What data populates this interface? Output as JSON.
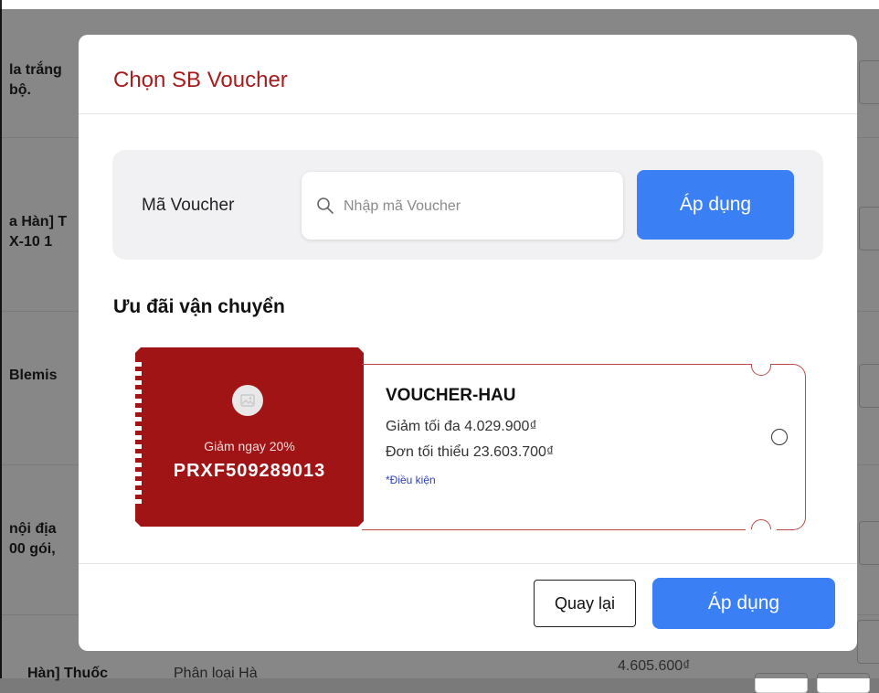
{
  "background": {
    "rows": [
      {
        "line1": "la trắng",
        "line2": "bộ."
      },
      {
        "line1": "a Hàn] T",
        "line2": "X-10 1"
      },
      {
        "line1": "Blemis",
        "line2": ""
      },
      {
        "line1": "nội địa",
        "line2": "00 gói,"
      }
    ],
    "bottom_name": "Hàn] Thuốc",
    "bottom_name2": "Phân loại Hà",
    "bottom_price": "4.605.600₫"
  },
  "modal": {
    "title": "Chọn SB Voucher",
    "voucher_code_label": "Mã Voucher",
    "search_placeholder": "Nhập mã Voucher",
    "search_value": "",
    "apply_label": "Áp dụng",
    "section_title": "Ưu đãi vận chuyển",
    "voucher": {
      "discount_text": "Giảm ngay 20%",
      "code": "PRXF509289013",
      "name": "VOUCHER-HAU",
      "max_discount": "Giảm tối đa 4.029.900₫",
      "min_order": "Đơn tối thiểu 23.603.700₫",
      "conditions_link": "*Điều kiện",
      "selected": false
    },
    "back_label": "Quay lại",
    "footer_apply_label": "Áp dụng"
  },
  "colors": {
    "title_red": "#a61c1c",
    "voucher_red": "#a01416",
    "primary_blue": "#3b7ff5",
    "link_blue": "#2e3fbf"
  },
  "icons": {
    "search": "search-icon",
    "voucher_image": "image-placeholder-icon",
    "radio": "radio-unchecked-icon"
  }
}
